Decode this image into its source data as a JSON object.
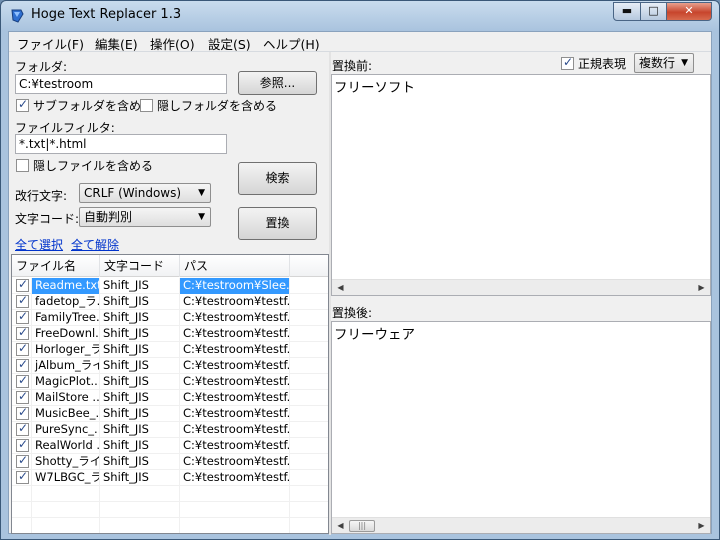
{
  "window": {
    "title": "Hoge Text Replacer 1.3",
    "min_glyph": "▬",
    "max_glyph": "□",
    "close_glyph": "✕"
  },
  "menu": [
    "ファイル(F)",
    "編集(E)",
    "操作(O)",
    "設定(S)",
    "ヘルプ(H)"
  ],
  "folder": {
    "label": "フォルダ:",
    "value": "C:¥testroom",
    "browse_label": "参照..."
  },
  "options": {
    "include_subfolders": {
      "label": "サブフォルダを含める",
      "checked": true
    },
    "include_hidden_folders": {
      "label": "隠しフォルダを含める",
      "checked": false
    },
    "include_hidden_files": {
      "label": "隠しファイルを含める",
      "checked": false
    }
  },
  "file_filter": {
    "label": "ファイルフィルタ:",
    "value": "*.txt|*.html"
  },
  "newline": {
    "label": "改行文字:",
    "selected": "CRLF (Windows)"
  },
  "encoding": {
    "label": "文字コード:",
    "selected": "自動判別"
  },
  "actions": {
    "search_label": "検索",
    "replace_label": "置換",
    "select_all": "全て選択",
    "deselect_all": "全て解除"
  },
  "table": {
    "columns": [
      "ファイル名",
      "文字コード",
      "パス"
    ],
    "rows": [
      {
        "name": "Readme.txt",
        "enc": "Shift_JIS",
        "path": "C:¥testroom¥Slee...",
        "checked": true,
        "selected": true
      },
      {
        "name": "fadetop_ラ...",
        "enc": "Shift_JIS",
        "path": "C:¥testroom¥testf...",
        "checked": true,
        "selected": false
      },
      {
        "name": "FamilyTree...",
        "enc": "Shift_JIS",
        "path": "C:¥testroom¥testf...",
        "checked": true,
        "selected": false
      },
      {
        "name": "FreeDownl...",
        "enc": "Shift_JIS",
        "path": "C:¥testroom¥testf...",
        "checked": true,
        "selected": false
      },
      {
        "name": "Horloger_ラ...",
        "enc": "Shift_JIS",
        "path": "C:¥testroom¥testf...",
        "checked": true,
        "selected": false
      },
      {
        "name": "jAlbum_ライ...",
        "enc": "Shift_JIS",
        "path": "C:¥testroom¥testf...",
        "checked": true,
        "selected": false
      },
      {
        "name": "MagicPlot...",
        "enc": "Shift_JIS",
        "path": "C:¥testroom¥testf...",
        "checked": true,
        "selected": false
      },
      {
        "name": "MailStore ...",
        "enc": "Shift_JIS",
        "path": "C:¥testroom¥testf...",
        "checked": true,
        "selected": false
      },
      {
        "name": "MusicBee_...",
        "enc": "Shift_JIS",
        "path": "C:¥testroom¥testf...",
        "checked": true,
        "selected": false
      },
      {
        "name": "PureSync_...",
        "enc": "Shift_JIS",
        "path": "C:¥testroom¥testf...",
        "checked": true,
        "selected": false
      },
      {
        "name": "RealWorld ...",
        "enc": "Shift_JIS",
        "path": "C:¥testroom¥testf...",
        "checked": true,
        "selected": false
      },
      {
        "name": "Shotty_ライ...",
        "enc": "Shift_JIS",
        "path": "C:¥testroom¥testf...",
        "checked": true,
        "selected": false
      },
      {
        "name": "W7LBGC_ラ...",
        "enc": "Shift_JIS",
        "path": "C:¥testroom¥testf...",
        "checked": true,
        "selected": false
      }
    ]
  },
  "before": {
    "label": "置換前:",
    "text": "フリーソフト",
    "regex_label": "正規表現",
    "regex_checked": true,
    "mode_selected": "複数行"
  },
  "after": {
    "label": "置換後:",
    "text": "フリーウェア"
  },
  "icons": {
    "app": "app-icon",
    "scroll_left": "◀",
    "scroll_right": "▶",
    "thumb_grip": "|||",
    "dropdown": "▼"
  }
}
